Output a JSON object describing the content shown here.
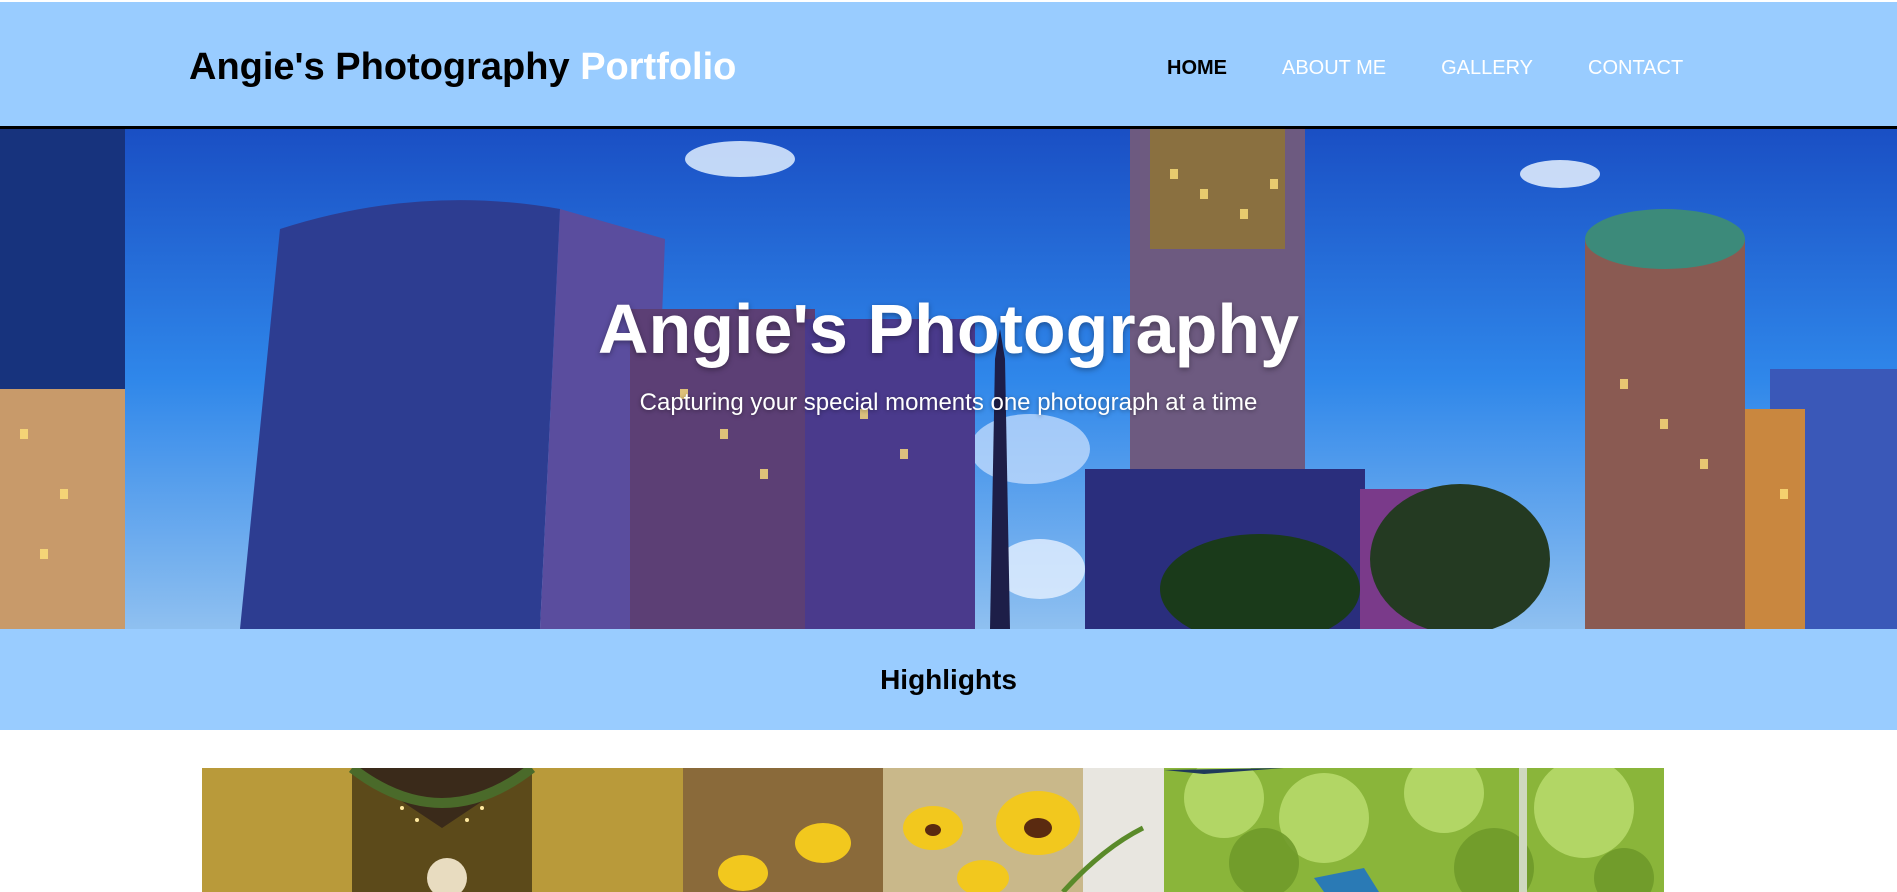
{
  "header": {
    "brand_main": "Angie's Photography",
    "brand_accent": "Portfolio",
    "nav": [
      {
        "label": "HOME",
        "active": true
      },
      {
        "label": "ABOUT ME",
        "active": false
      },
      {
        "label": "GALLERY",
        "active": false
      },
      {
        "label": "CONTACT",
        "active": false
      }
    ]
  },
  "hero": {
    "title": "Angie's Photography",
    "subtitle": "Capturing your special moments one photograph at a time"
  },
  "highlights": {
    "heading": "Highlights"
  },
  "gallery": {
    "images": [
      {
        "name": "wedding-photo"
      },
      {
        "name": "yellow-pansies-photo"
      },
      {
        "name": "garden-greenery-photo"
      }
    ]
  },
  "colors": {
    "header_bg": "#99ccff",
    "brand_accent": "#ffffff",
    "nav_active": "#000000",
    "nav_inactive": "#ffffff"
  }
}
